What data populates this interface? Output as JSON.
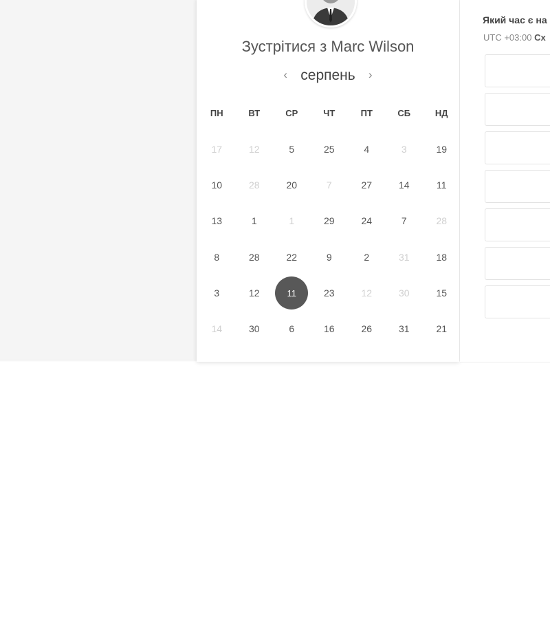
{
  "host": {
    "meet_title": "Зустрітися з Marc Wilson"
  },
  "calendar": {
    "month": "серпень",
    "prev_icon": "chevron-left-icon",
    "next_icon": "chevron-right-icon",
    "weekdays": [
      "ПН",
      "ВТ",
      "СР",
      "ЧТ",
      "ПТ",
      "СБ",
      "НД"
    ],
    "weeks": [
      [
        {
          "d": "17",
          "off": true
        },
        {
          "d": "12",
          "off": true
        },
        {
          "d": "5"
        },
        {
          "d": "25"
        },
        {
          "d": "4"
        },
        {
          "d": "3",
          "off": true
        },
        {
          "d": "19"
        }
      ],
      [
        {
          "d": "10"
        },
        {
          "d": "28",
          "off": true
        },
        {
          "d": "20"
        },
        {
          "d": "7",
          "off": true
        },
        {
          "d": "27"
        },
        {
          "d": "14"
        },
        {
          "d": "11"
        }
      ],
      [
        {
          "d": "13"
        },
        {
          "d": "1"
        },
        {
          "d": "1",
          "off": true
        },
        {
          "d": "29"
        },
        {
          "d": "24"
        },
        {
          "d": "7"
        },
        {
          "d": "28",
          "off": true
        }
      ],
      [
        {
          "d": "8"
        },
        {
          "d": "28"
        },
        {
          "d": "22"
        },
        {
          "d": "9"
        },
        {
          "d": "2"
        },
        {
          "d": "31",
          "off": true
        },
        {
          "d": "18"
        }
      ],
      [
        {
          "d": "3"
        },
        {
          "d": "12"
        },
        {
          "d": "11",
          "selected": true
        },
        {
          "d": "23"
        },
        {
          "d": "12",
          "off": true
        },
        {
          "d": "30",
          "off": true
        },
        {
          "d": "15"
        }
      ],
      [
        {
          "d": "14",
          "off": true
        },
        {
          "d": "30"
        },
        {
          "d": "6"
        },
        {
          "d": "16"
        },
        {
          "d": "26"
        },
        {
          "d": "31"
        },
        {
          "d": "21"
        }
      ]
    ]
  },
  "timezone": {
    "question": "Який час є на",
    "offset": "UTC +03:00",
    "region": "Сх"
  },
  "time_slots_count": 7,
  "colors": {
    "selected_day": "#585858",
    "disabled_day": "#d0d0d0"
  }
}
